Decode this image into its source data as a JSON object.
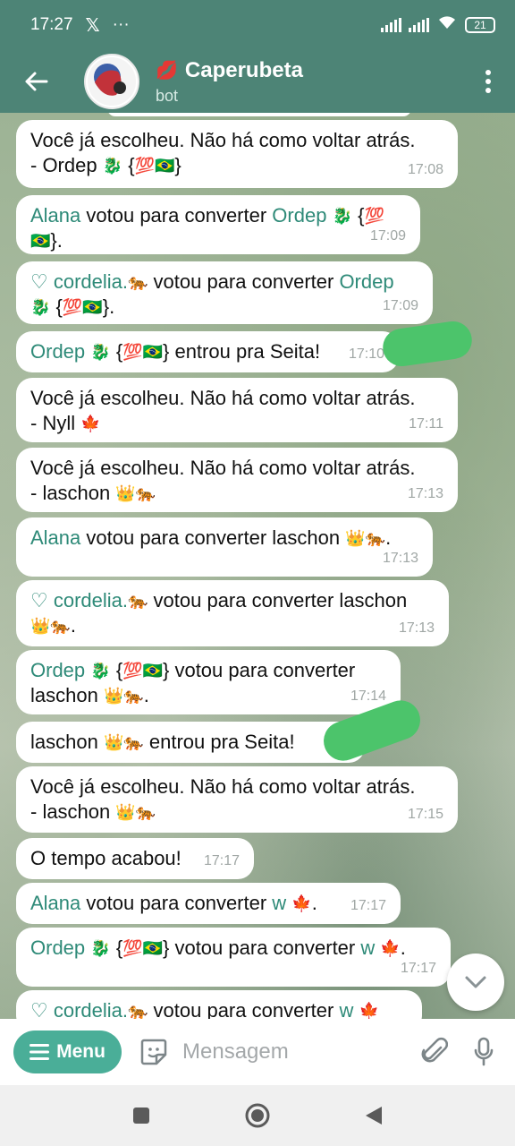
{
  "status_bar": {
    "time": "17:27",
    "notification_icons": [
      "x-icon",
      "more-icon"
    ],
    "dots": "···",
    "battery": "21"
  },
  "header": {
    "title": "Caperubeta",
    "subtitle": "bot",
    "title_emoji": "lips-icon"
  },
  "messages": [
    {
      "parts": [
        {
          "t": "Você já escolheu. Não há como voltar atrás."
        },
        {
          "br": true
        },
        {
          "t": "- Ordep "
        },
        {
          "e": "🐉"
        },
        {
          "t": " {"
        },
        {
          "e": "💯🇧🇷"
        },
        {
          "t": "}"
        }
      ],
      "time": "17:08"
    },
    {
      "parts": [
        {
          "n": "Alana"
        },
        {
          "t": " votou para converter "
        },
        {
          "n": "Ordep"
        },
        {
          "t": " "
        },
        {
          "e": "🐉"
        },
        {
          "t": " {"
        },
        {
          "e": "💯"
        },
        {
          "br": true
        },
        {
          "e": "🇧🇷"
        },
        {
          "t": "}."
        }
      ],
      "time": "17:09"
    },
    {
      "parts": [
        {
          "n": "♡ cordelia."
        },
        {
          "e": "🐅"
        },
        {
          "t": " votou para converter "
        },
        {
          "n": "Ordep"
        },
        {
          "br": true
        },
        {
          "e": "🐉"
        },
        {
          "t": " {"
        },
        {
          "e": "💯🇧🇷"
        },
        {
          "t": "}."
        }
      ],
      "time": "17:09"
    },
    {
      "parts": [
        {
          "n": "Ordep"
        },
        {
          "t": " "
        },
        {
          "e": "🐉"
        },
        {
          "t": " {"
        },
        {
          "e": "💯🇧🇷"
        },
        {
          "t": "} entrou pra Seita!"
        }
      ],
      "time": "17:10"
    },
    {
      "parts": [
        {
          "t": "Você já escolheu. Não há como voltar atrás."
        },
        {
          "br": true
        },
        {
          "t": "- Nyll "
        },
        {
          "e": "🍁"
        }
      ],
      "time": "17:11"
    },
    {
      "parts": [
        {
          "t": "Você já escolheu. Não há como voltar atrás."
        },
        {
          "br": true
        },
        {
          "t": "- laschon "
        },
        {
          "e": "👑🐅"
        }
      ],
      "time": "17:13"
    },
    {
      "parts": [
        {
          "n": "Alana"
        },
        {
          "t": " votou para converter laschon "
        },
        {
          "e": "👑🐅"
        },
        {
          "t": "."
        }
      ],
      "time": "17:13"
    },
    {
      "parts": [
        {
          "n": "♡ cordelia."
        },
        {
          "e": "🐅"
        },
        {
          "t": " votou para converter laschon"
        },
        {
          "br": true
        },
        {
          "e": "👑🐅"
        },
        {
          "t": "."
        }
      ],
      "time": "17:13"
    },
    {
      "parts": [
        {
          "n": "Ordep"
        },
        {
          "t": " "
        },
        {
          "e": "🐉"
        },
        {
          "t": " {"
        },
        {
          "e": "💯🇧🇷"
        },
        {
          "t": "} votou para converter"
        },
        {
          "br": true
        },
        {
          "t": "laschon "
        },
        {
          "e": "👑🐅"
        },
        {
          "t": "."
        }
      ],
      "time": "17:14"
    },
    {
      "parts": [
        {
          "t": "laschon "
        },
        {
          "e": "👑🐅"
        },
        {
          "t": " entrou pra Seita!"
        }
      ],
      "time": ""
    },
    {
      "parts": [
        {
          "t": "Você já escolheu. Não há como voltar atrás."
        },
        {
          "br": true
        },
        {
          "t": "- laschon "
        },
        {
          "e": "👑🐅"
        }
      ],
      "time": "17:15"
    },
    {
      "parts": [
        {
          "t": "O tempo acabou!"
        }
      ],
      "time": "17:17"
    },
    {
      "parts": [
        {
          "n": "Alana"
        },
        {
          "t": " votou para converter "
        },
        {
          "n": "w"
        },
        {
          "t": " "
        },
        {
          "e": "🍁"
        },
        {
          "t": "."
        }
      ],
      "time": "17:17"
    },
    {
      "parts": [
        {
          "n": "Ordep"
        },
        {
          "t": " "
        },
        {
          "e": "🐉"
        },
        {
          "t": " {"
        },
        {
          "e": "💯🇧🇷"
        },
        {
          "t": "} votou para converter "
        },
        {
          "n": "w"
        },
        {
          "t": " "
        },
        {
          "e": "🍁"
        },
        {
          "t": "."
        }
      ],
      "time": "17:17"
    },
    {
      "parts": [
        {
          "n": "♡ cordelia."
        },
        {
          "e": "🐅"
        },
        {
          "t": " votou para converter "
        },
        {
          "n": "w"
        },
        {
          "t": " "
        },
        {
          "e": "🍁"
        }
      ],
      "time": ""
    }
  ],
  "input": {
    "menu_label": "Menu",
    "placeholder": "Mensagem"
  },
  "colors": {
    "header": "#4d8476",
    "name": "#2e8a78",
    "menu_button": "#4aae98",
    "redaction": "#4cc46b"
  }
}
